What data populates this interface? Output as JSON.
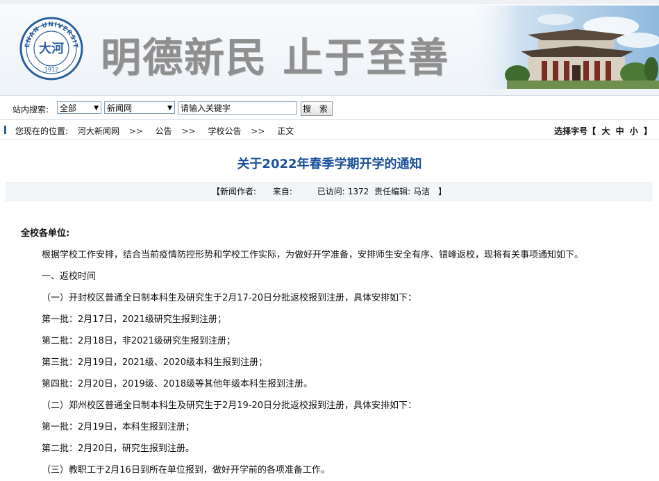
{
  "header": {
    "seal_text": "HENAN UNIVERSITY",
    "seal_year": "1912",
    "seal_center": "大河",
    "slogan": "明德新民  止于至善"
  },
  "search": {
    "label": "站内搜索:",
    "scope_selected": "全部",
    "site_selected": "新闻网",
    "keyword_value": "请输入关键字",
    "button_label": "搜 索"
  },
  "breadcrumb": {
    "prefix": "您现在的位置:",
    "items": [
      "河大新闻网",
      "公告",
      "学校公告",
      "正文"
    ],
    "separator": ">>"
  },
  "font_size": {
    "label": "选择字号【",
    "options": [
      "大",
      "中",
      "小"
    ],
    "suffix": "】"
  },
  "article": {
    "title": "关于2022年春季学期开学的通知",
    "meta": {
      "author_label": "【新闻作者:",
      "source_label": "来自:",
      "visits_label": "已访问:",
      "visits_value": "1372",
      "editor_label": "责任编辑:",
      "editor_value": "马洁",
      "close": "】"
    },
    "salutation": "全校各单位:",
    "paragraphs": [
      "根据学校工作安排，结合当前疫情防控形势和学校工作实际，为做好开学准备，安排师生安全有序、错峰返校，现将有关事项通知如下。",
      "一、返校时间",
      "（一）开封校区普通全日制本科生及研究生于2月17-20日分批返校报到注册，具体安排如下：",
      "第一批：2月17日，2021级研究生报到注册；",
      "第二批：2月18日，非2021级研究生报到注册；",
      "第三批：2月19日，2021级、2020级本科生报到注册；",
      "第四批：2月20日，2019级、2018级等其他年级本科生报到注册。",
      "（二）郑州校区普通全日制本科生及研究生于2月19-20日分批返校报到注册，具体安排如下：",
      "第一批：2月19日，本科生报到注册；",
      "第二批：2月20日，研究生报到注册。",
      "（三）教职工于2月16日到所在单位报到，做好开学前的各项准备工作。"
    ]
  },
  "colors": {
    "title_blue": "#1a4f99",
    "slogan_gray": "#8f8f8f",
    "seal_blue": "#2b5e9e"
  }
}
